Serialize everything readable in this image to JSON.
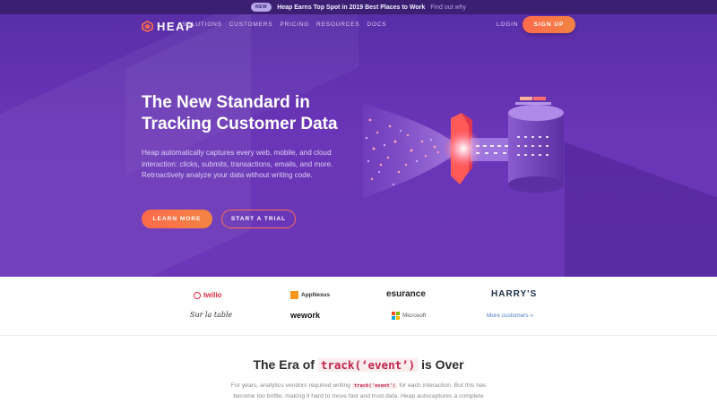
{
  "announcement": {
    "badge": "NEW",
    "message": "Heap Earns Top Spot in 2019 Best Places to Work",
    "link": "Find out why"
  },
  "nav": {
    "logo_text": "HEAP",
    "links": [
      "SOLUTIONS",
      "CUSTOMERS",
      "PRICING",
      "RESOURCES",
      "DOCS"
    ],
    "login": "LOGIN",
    "signup": "SIGN UP"
  },
  "hero": {
    "headline_line1": "The New Standard in",
    "headline_line2": "Tracking Customer Data",
    "subtext": "Heap automatically captures every web, mobile, and cloud interaction: clicks, submits, transactions, emails, and more. Retroactively analyze your data without writing code.",
    "learn_more": "LEARN MORE",
    "start_trial": "START A TRIAL"
  },
  "customers": {
    "row1": [
      "twilio",
      "AppNexus",
      "esurance",
      "HARRY'S"
    ],
    "row2": [
      "Sur la table",
      "wework",
      "Microsoft"
    ],
    "more": "More customers »"
  },
  "era": {
    "title_prefix": "The Era of",
    "title_code": "track(‘event’)",
    "title_suffix": "is Over",
    "body_prefix": "For years, analytics vendors required writing",
    "body_code": "track('event')",
    "body_suffix": "for each interaction. But this has become too brittle, making it hard to move fast and trust data. Heap autocaptures a complete"
  },
  "colors": {
    "hero_purple": "#6a35b7",
    "announce_bg": "#3a1f73",
    "accent_orange": "#ff6a4d",
    "code_red": "#c0254a",
    "link_blue": "#4d7cc7"
  }
}
